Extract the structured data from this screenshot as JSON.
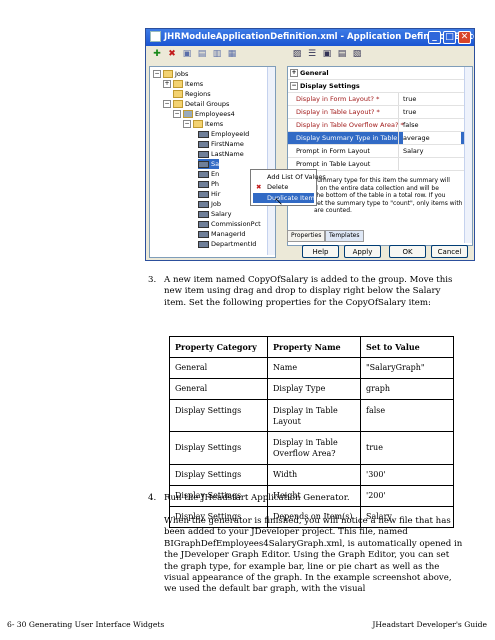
{
  "window": {
    "title": "JHRModuleApplicationDefinition.xml - Application Definition Editor",
    "tree_nodes": [
      "Jobs",
      "Items",
      "Regions",
      "Detail Groups",
      "Employees4",
      "Items",
      "EmployeeId",
      "FirstName",
      "LastName",
      "Sa",
      "En",
      "Ph",
      "Hir",
      "Job",
      "Salary",
      "CommissionPct",
      "ManagerId",
      "DepartmentId"
    ],
    "properties": {
      "section_general": "General",
      "section_display": "Display Settings",
      "rows": [
        {
          "name": "Display in Form Layout? *",
          "value": "true"
        },
        {
          "name": "Display in Table Layout? *",
          "value": "true"
        },
        {
          "name": "Display in Table Overflow Area? *",
          "value": "false"
        },
        {
          "name": "Display Summary Type in Table",
          "value": "average"
        },
        {
          "name": "Prompt in Form Layout",
          "value": "Salary"
        },
        {
          "name": "Prompt in Table Layout",
          "value": ""
        }
      ],
      "description": "summary type for this item the summary will\nd on the entire data collection and will be\nthe bottom of the table in a total row. If you\nset the summary type to \"count\", only items with a value\nare counted."
    },
    "tabs": [
      "Properties",
      "Templates"
    ],
    "context_menu": [
      "Add List Of Values",
      "Delete",
      "Duplicate Item"
    ],
    "buttons": {
      "help": "Help",
      "apply": "Apply",
      "ok": "OK",
      "cancel": "Cancel"
    }
  },
  "step3": {
    "number": "3.",
    "text": "A new item named CopyOfSalary is added to the group. Move this new item using drag and drop to display right below the Salary item. Set the following properties for the CopyOfSalary item:"
  },
  "table": {
    "headers": [
      "Property Category",
      "Property Name",
      "Set to Value"
    ],
    "rows": [
      [
        "General",
        "Name",
        "\"SalaryGraph\""
      ],
      [
        "General",
        "Display Type",
        "graph"
      ],
      [
        "Display Settings",
        "Display in Table Layout",
        "false"
      ],
      [
        "Display Settings",
        "Display in Table Overflow Area?",
        "true"
      ],
      [
        "Display Settings",
        "Width",
        "'300'"
      ],
      [
        "Display Settings",
        "Height",
        "'200'"
      ],
      [
        "Display Settings",
        "Depends on Item(s)",
        "Salary"
      ]
    ]
  },
  "step4": {
    "number": "4.",
    "text": "Run the JHeadstart Application Generator."
  },
  "paragraph": "When the generator is finished, you will notice a new file that has been added to your JDeveloper project. This file, named BIGraphDefEmployees4SalaryGraph.xml, is automatically opened in the JDeveloper Graph Editor. Using the Graph Editor, you can set the graph type, for example bar, line or pie chart as well as the visual appearance of the graph. In the example screenshot above, we used the default bar graph, with the visual",
  "footer": {
    "left": "6- 30 Generating User Interface Widgets",
    "right": "JHeadstart Developer's Guide"
  }
}
